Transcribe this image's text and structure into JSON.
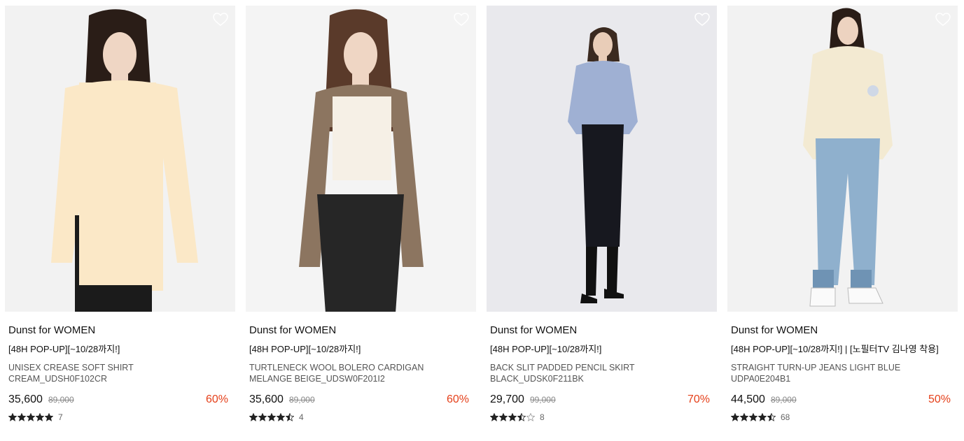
{
  "products": [
    {
      "brand": "Dunst for WOMEN",
      "promo": "[48H POP-UP][~10/28까지!]",
      "name_line1": "UNISEX CREASE SOFT SHIRT",
      "name_line2": "CREAM_UDSH0F102CR",
      "price": "35,600",
      "original_price": "89,000",
      "discount": "60%",
      "rating": 5,
      "review_count": "7",
      "image_bg": "#f2f2f2",
      "garment_colors": {
        "top": "#fbe8c7",
        "bottom": "#1b1b1b",
        "hair": "#2a1d17"
      }
    },
    {
      "brand": "Dunst for WOMEN",
      "promo": "[48H POP-UP][~10/28까지!]",
      "name_line1": "TURTLENECK WOOL BOLERO CARDIGAN",
      "name_line2": "MELANGE BEIGE_UDSW0F201I2",
      "price": "35,600",
      "original_price": "89,000",
      "discount": "60%",
      "rating": 4.5,
      "review_count": "4",
      "image_bg": "#f4f4f4",
      "garment_colors": {
        "top": "#8c7560",
        "bottom": "#262626",
        "hair": "#5a3a2a"
      }
    },
    {
      "brand": "Dunst for WOMEN",
      "promo": "[48H POP-UP][~10/28까지!]",
      "name_line1": "BACK SLIT PADDED PENCIL SKIRT",
      "name_line2": "BLACK_UDSK0F211BK",
      "price": "29,700",
      "original_price": "99,000",
      "discount": "70%",
      "rating": 3.5,
      "review_count": "8",
      "image_bg": "#e9e9ed",
      "garment_colors": {
        "top": "#9fb0d3",
        "bottom": "#17181f",
        "hair": "#3b2a20"
      }
    },
    {
      "brand": "Dunst for WOMEN",
      "promo": "[48H POP-UP][~10/28까지!] | [노필터TV 김나영 착용]",
      "name_line1": "STRAIGHT TURN-UP JEANS LIGHT BLUE",
      "name_line2": "UDPA0E204B1",
      "price": "44,500",
      "original_price": "89,000",
      "discount": "50%",
      "rating": 4.5,
      "review_count": "68",
      "image_bg": "#f2f2f2",
      "garment_colors": {
        "top": "#f3ead2",
        "bottom": "#8fb0cd",
        "hair": "#2a1d17"
      }
    }
  ],
  "colors": {
    "discount": "#e5401a",
    "star": "#222222",
    "star_empty": "#cccccc"
  },
  "icons": {
    "wishlist": "heart-outline-icon",
    "star": "star-icon"
  }
}
